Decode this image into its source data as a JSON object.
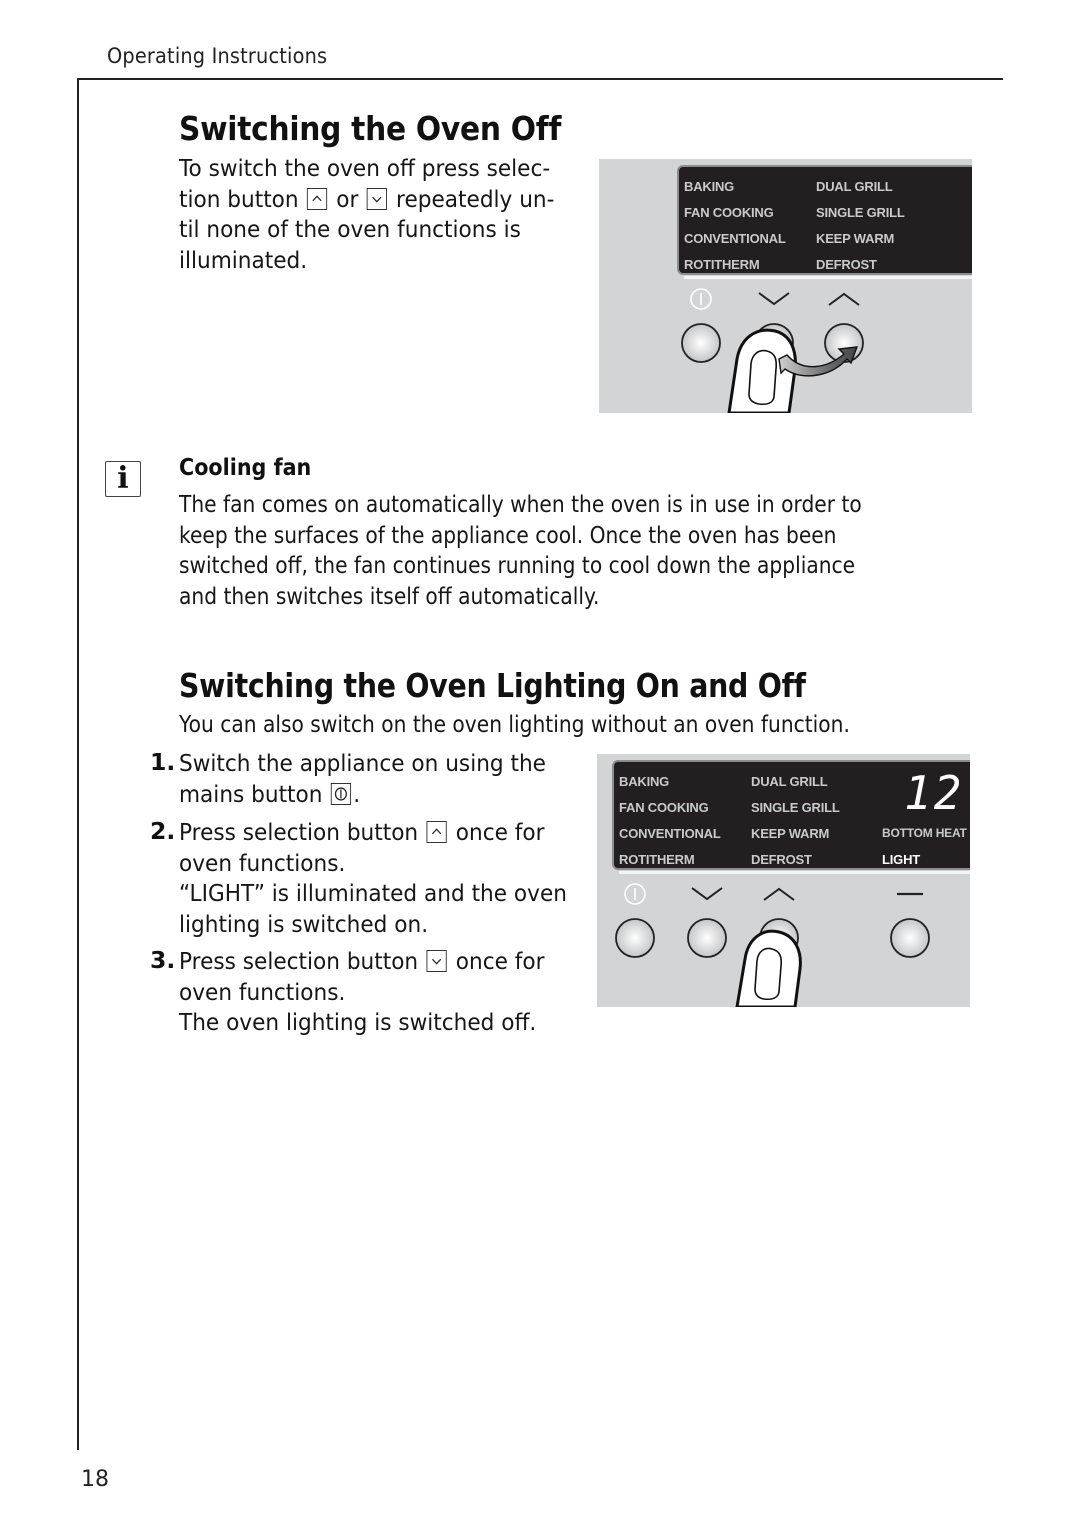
{
  "header": {
    "running_title": "Operating Instructions"
  },
  "page_number": "18",
  "section1": {
    "title": "Switching the Oven Off",
    "lines": [
      {
        "before": "To switch the oven off press selec-"
      },
      {
        "before": "tion button ",
        "key1": "up-arrow",
        "middle": " or ",
        "key2": "down-arrow",
        "after": " repeatedly un-"
      },
      {
        "before": "til none of the oven functions is"
      },
      {
        "before": "illuminated."
      }
    ]
  },
  "note": {
    "icon": "info-icon",
    "title": "Cooling fan",
    "lines": [
      "The fan comes on automatically when the oven is in use in order to",
      "keep the surfaces of the appliance cool. Once the oven has been",
      "switched off, the fan continues running to cool down the appliance",
      "and then switches itself off automatically."
    ]
  },
  "section2": {
    "title": "Switching the Oven Lighting On and Off",
    "intro": "You can also switch on the oven lighting without an oven function.",
    "steps": [
      {
        "number": "1.",
        "lines": [
          {
            "before": "Switch the appliance on using the"
          },
          {
            "before": "mains button ",
            "key": "power",
            "after": "."
          }
        ]
      },
      {
        "number": "2.",
        "lines": [
          {
            "before": "Press selection button ",
            "key": "up-arrow",
            "after": " once for"
          },
          {
            "before": "oven functions."
          },
          {
            "before": "“LIGHT” is illuminated and the oven"
          },
          {
            "before": "lighting is switched on."
          }
        ]
      },
      {
        "number": "3.",
        "lines": [
          {
            "before": "Press selection button ",
            "key": "down-arrow",
            "after": " once for"
          },
          {
            "before": "oven functions."
          },
          {
            "before": "The oven lighting is switched off."
          }
        ]
      }
    ]
  },
  "panel1": {
    "functions_col1": [
      "BAKING",
      "FAN COOKING",
      "CONVENTIONAL",
      "ROTITHERM"
    ],
    "functions_col2": [
      "DUAL GRILL",
      "SINGLE GRILL",
      "KEEP WARM",
      "DEFROST"
    ],
    "button_icons": [
      "power-icon",
      "chevron-down-icon",
      "chevron-up-icon"
    ],
    "gesture": "finger pressing down button, arrow towards up button"
  },
  "panel2": {
    "functions_col1": [
      "BAKING",
      "FAN COOKING",
      "CONVENTIONAL",
      "ROTITHERM"
    ],
    "functions_col2": [
      "DUAL GRILL",
      "SINGLE GRILL",
      "KEEP WARM",
      "DEFROST"
    ],
    "functions_col3": [
      "BOTTOM HEAT",
      "LIGHT"
    ],
    "lit_function": "LIGHT",
    "time_display": "12.0",
    "button_icons": [
      "power-icon",
      "chevron-down-icon",
      "chevron-up-icon",
      "minus-icon"
    ],
    "gesture": "finger pressing up button"
  },
  "colors": {
    "panel_grey": "#d3d4d6",
    "display_black": "#231f20",
    "display_text": "#c9cacc",
    "display_text_lit": "#ffffff"
  }
}
